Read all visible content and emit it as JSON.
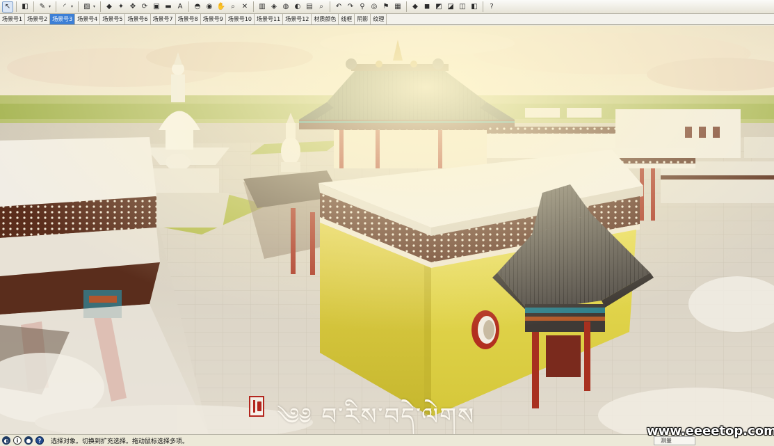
{
  "toolbar": {
    "tools": [
      {
        "name": "select-tool-icon",
        "glyph": "↖",
        "active": true
      },
      {
        "name": "eraser-tool-icon",
        "glyph": "◧"
      },
      {
        "name": "pencil-line-tool-icon",
        "glyph": "✎"
      },
      {
        "name": "line-dropdown-icon",
        "glyph": "▾"
      },
      {
        "name": "arc-tool-icon",
        "glyph": "◜"
      },
      {
        "name": "arc-dropdown-icon",
        "glyph": "▾"
      },
      {
        "name": "rectangle-tool-icon",
        "glyph": "▨"
      },
      {
        "name": "rectangle-dropdown-icon",
        "glyph": "▾"
      },
      {
        "name": "push-pull-tool-icon",
        "glyph": "◆"
      },
      {
        "name": "offset-tool-icon",
        "glyph": "✦"
      },
      {
        "name": "move-tool-icon",
        "glyph": "✥"
      },
      {
        "name": "rotate-tool-icon",
        "glyph": "⟳"
      },
      {
        "name": "scale-tool-icon",
        "glyph": "▣"
      },
      {
        "name": "tape-measure-tool-icon",
        "glyph": "▬"
      },
      {
        "name": "text-tool-icon",
        "glyph": "A"
      },
      {
        "name": "paint-bucket-tool-icon",
        "glyph": "◓"
      },
      {
        "name": "orbit-tool-icon",
        "glyph": "◉"
      },
      {
        "name": "pan-tool-icon",
        "glyph": "✋"
      },
      {
        "name": "zoom-tool-icon",
        "glyph": "⌕"
      },
      {
        "name": "zoom-extents-tool-icon",
        "glyph": "✕"
      },
      {
        "name": "section-plane-icon",
        "glyph": "▥"
      },
      {
        "name": "component-icon",
        "glyph": "◈"
      },
      {
        "name": "materials-icon",
        "glyph": "◍"
      },
      {
        "name": "styles-icon",
        "glyph": "◐"
      },
      {
        "name": "layers-icon",
        "glyph": "▤"
      },
      {
        "name": "zoom-window-icon",
        "glyph": "⌕"
      },
      {
        "name": "previous-view-icon",
        "glyph": "↶"
      },
      {
        "name": "next-view-icon",
        "glyph": "↷"
      },
      {
        "name": "walk-icon",
        "glyph": "⚲"
      },
      {
        "name": "look-around-icon",
        "glyph": "◎"
      },
      {
        "name": "position-camera-icon",
        "glyph": "⚑"
      },
      {
        "name": "sandbox-icon",
        "glyph": "▦"
      },
      {
        "name": "iso-view-icon",
        "glyph": "◆"
      },
      {
        "name": "top-view-icon",
        "glyph": "◼"
      },
      {
        "name": "front-view-icon",
        "glyph": "◩"
      },
      {
        "name": "right-view-icon",
        "glyph": "◪"
      },
      {
        "name": "back-view-icon",
        "glyph": "◫"
      },
      {
        "name": "left-view-icon",
        "glyph": "◧"
      },
      {
        "name": "help-icon",
        "glyph": "?"
      }
    ]
  },
  "scenes": {
    "tabs": [
      "场景号1",
      "场景号2",
      "场景号3",
      "场景号4",
      "场景号5",
      "场景号6",
      "场景号7",
      "场景号8",
      "场景号9",
      "场景号10",
      "场景号11",
      "场景号12",
      "材质颜色",
      "线框",
      "阴影",
      "纹理"
    ],
    "selected_index": 2
  },
  "viewport": {
    "tibetan_text": "༄༅ བ་རིས་བདེ་ལེགས",
    "colors": {
      "sky": "#efe6d2",
      "sunlight": "#fff4c8",
      "grass": "#9fb04a",
      "yellow_wall": "#d7c93a",
      "roof_green": "#5d6a4a",
      "roof_dark": "#4a4540",
      "trim_brown": "#5a2d1c",
      "pillar_red": "#b2301f",
      "white_roof": "#f2efe8",
      "stone_floor": "#d9d2c4"
    }
  },
  "statusbar": {
    "message": "选择对象。切换到扩充选择。拖动鼠标选择多项。",
    "measure_label": "测量"
  },
  "overlay": {
    "site": "www.eeeetop.com"
  }
}
